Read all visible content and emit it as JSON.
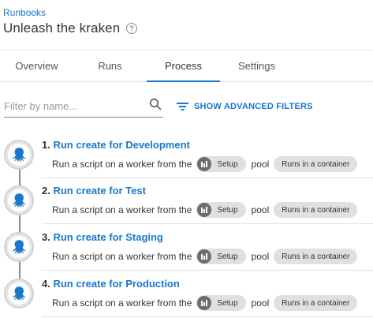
{
  "breadcrumb": "Runbooks",
  "page_title": "Unleash the kraken",
  "help_icon": "?",
  "tabs": [
    {
      "label": "Overview",
      "active": false
    },
    {
      "label": "Runs",
      "active": false
    },
    {
      "label": "Process",
      "active": true
    },
    {
      "label": "Settings",
      "active": false
    }
  ],
  "filter": {
    "placeholder": "Filter by name...",
    "value": ""
  },
  "advanced_filters_label": "SHOW ADVANCED FILTERS",
  "steps": [
    {
      "number": "1.",
      "name": "Run create for Development",
      "desc": "Run a script on a worker from the",
      "pool_name": "Setup",
      "pool_word": "pool",
      "badge": "Runs in a container"
    },
    {
      "number": "2.",
      "name": "Run create for Test",
      "desc": "Run a script on a worker from the",
      "pool_name": "Setup",
      "pool_word": "pool",
      "badge": "Runs in a container"
    },
    {
      "number": "3.",
      "name": "Run create for Staging",
      "desc": "Run a script on a worker from the",
      "pool_name": "Setup",
      "pool_word": "pool",
      "badge": "Runs in a container"
    },
    {
      "number": "4.",
      "name": "Run create for Production",
      "desc": "Run a script on a worker from the",
      "pool_name": "Setup",
      "pool_word": "pool",
      "badge": "Runs in a container"
    }
  ],
  "icons": {
    "help": "help-circle-icon",
    "search": "search-icon",
    "filter": "filter-lines-icon",
    "step": "octopus-icon",
    "pool": "worker-pool-icon"
  },
  "colors": {
    "accent": "#1a77ca",
    "text": "#333333",
    "chip": "#e0e0e0"
  }
}
